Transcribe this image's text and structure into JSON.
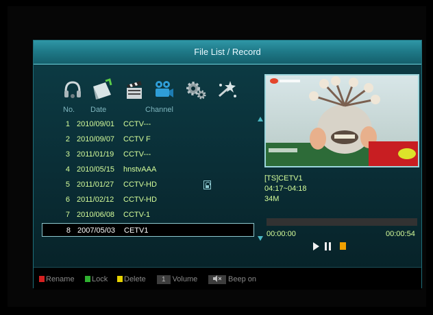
{
  "window": {
    "title": "File List / Record"
  },
  "columns": {
    "no": "No.",
    "date": "Date",
    "channel": "Channel"
  },
  "tool_icons": [
    "headset-icon",
    "note-icon",
    "clapperboard-icon",
    "camera-icon",
    "gears-icon",
    "sparkle-icon"
  ],
  "recordings": [
    {
      "no": "1",
      "date": "2010/09/01",
      "channel": "CCTV---",
      "locked": false
    },
    {
      "no": "2",
      "date": "2010/09/07",
      "channel": "CCTV F",
      "locked": false
    },
    {
      "no": "3",
      "date": "2011/01/19",
      "channel": "CCTV---",
      "locked": false
    },
    {
      "no": "4",
      "date": "2010/05/15",
      "channel": "hnstvAAA",
      "locked": false
    },
    {
      "no": "5",
      "date": "2011/01/27",
      "channel": "CCTV-HD",
      "locked": true
    },
    {
      "no": "6",
      "date": "2011/02/12",
      "channel": "CCTV-HD",
      "locked": false
    },
    {
      "no": "7",
      "date": "2010/06/08",
      "channel": "CCTV-1",
      "locked": false
    },
    {
      "no": "8",
      "date": "2007/05/03",
      "channel": "CETV1",
      "locked": false,
      "selected": true
    }
  ],
  "preview": {
    "program": "[TS]CETV1",
    "time_range": "04:17~04:18",
    "size": "34M",
    "current_time": "00:00:00",
    "total_time": "00:00:54",
    "progress": 0.0
  },
  "footer": {
    "rename": "Rename",
    "lock": "Lock",
    "delete": "Delete",
    "volume_key": "1",
    "volume": "Volume",
    "beep": "Beep on"
  },
  "colors": {
    "red": "#d42020",
    "green": "#2fb030",
    "yellow": "#e6d200",
    "text": "#d7ff9b",
    "accent": "#1f7a89"
  }
}
